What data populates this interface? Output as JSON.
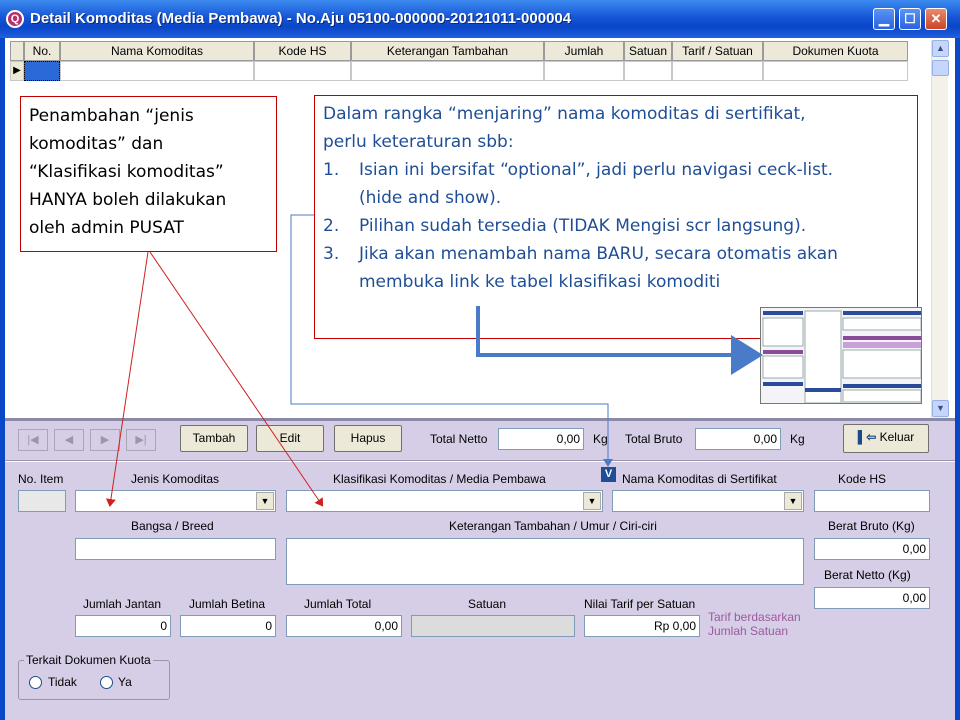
{
  "window": {
    "title": "Detail Komoditas (Media Pembawa) - No.Aju 05100-000000-20121011-000004",
    "app_icon": "Q",
    "buttons": {
      "minimize": "▁",
      "maximize": "☐",
      "close": "✕"
    }
  },
  "grid": {
    "columns": [
      "No.",
      "Nama Komoditas",
      "Kode HS",
      "Keterangan Tambahan",
      "Jumlah",
      "Satuan",
      "Tarif / Satuan",
      "Dokumen Kuota"
    ],
    "row_pointer": "▶"
  },
  "callouts": {
    "left": [
      "Penambahan “jenis",
      "komoditas” dan",
      "“Klasifikasi komoditas”",
      "HANYA boleh dilakukan",
      "oleh admin PUSAT"
    ],
    "right": {
      "intro_1": "Dalam rangka “menjaring” nama komoditas di sertifikat,",
      "intro_2": "perlu keteraturan sbb:",
      "items": [
        {
          "num": "1.",
          "line1": "Isian ini bersifat “optional”, jadi perlu navigasi ceck-list.",
          "line2": "(hide and show)."
        },
        {
          "num": "2.",
          "line1": "Pilihan sudah tersedia (TIDAK Mengisi scr langsung).",
          "line2": ""
        },
        {
          "num": "3.",
          "line1": "Jika akan menambah nama BARU, secara otomatis akan",
          "line2": "membuka link ke tabel klasifikasi komoditi"
        }
      ]
    },
    "badge": "V"
  },
  "toolbar": {
    "nav": [
      "|◀",
      "◀",
      "▶",
      "▶|"
    ],
    "tambah": "Tambah",
    "edit": "Edit",
    "hapus": "Hapus",
    "total_netto_label": "Total Netto",
    "total_netto": "0,00",
    "total_netto_unit": "Kg",
    "total_bruto_label": "Total Bruto",
    "total_bruto": "0,00",
    "total_bruto_unit": "Kg",
    "keluar": "Keluar"
  },
  "form": {
    "no_item_label": "No. Item",
    "jenis_label": "Jenis Komoditas",
    "klasifikasi_label": "Klasifikasi Komoditas / Media Pembawa",
    "nama_sertifikat_label": "Nama Komoditas di Sertifikat",
    "kode_hs_label": "Kode HS",
    "bangsa_label": "Bangsa / Breed",
    "keterangan_label": "Keterangan Tambahan / Umur / Ciri-ciri",
    "berat_bruto_label": "Berat Bruto (Kg)",
    "berat_bruto": "0,00",
    "berat_netto_label": "Berat Netto (Kg)",
    "berat_netto": "0,00",
    "jantan_label": "Jumlah Jantan",
    "jantan": "0",
    "betina_label": "Jumlah Betina",
    "betina": "0",
    "total_label": "Jumlah Total",
    "total": "0,00",
    "satuan_label": "Satuan",
    "tarif_label": "Nilai Tarif per Satuan",
    "tarif": "Rp 0,00",
    "tarif_note_1": "Tarif berdasarkan",
    "tarif_note_2": "Jumlah Satuan",
    "kuota_label": "Terkait Dokumen Kuota",
    "tidak": "Tidak",
    "ya": "Ya"
  },
  "colors": {
    "title_bar": "#0a46c8",
    "callout_border": "#c00000",
    "callout_text": "#1f4e96",
    "panel_bg": "#d6cee6",
    "arrow": "#4a7bc8"
  }
}
